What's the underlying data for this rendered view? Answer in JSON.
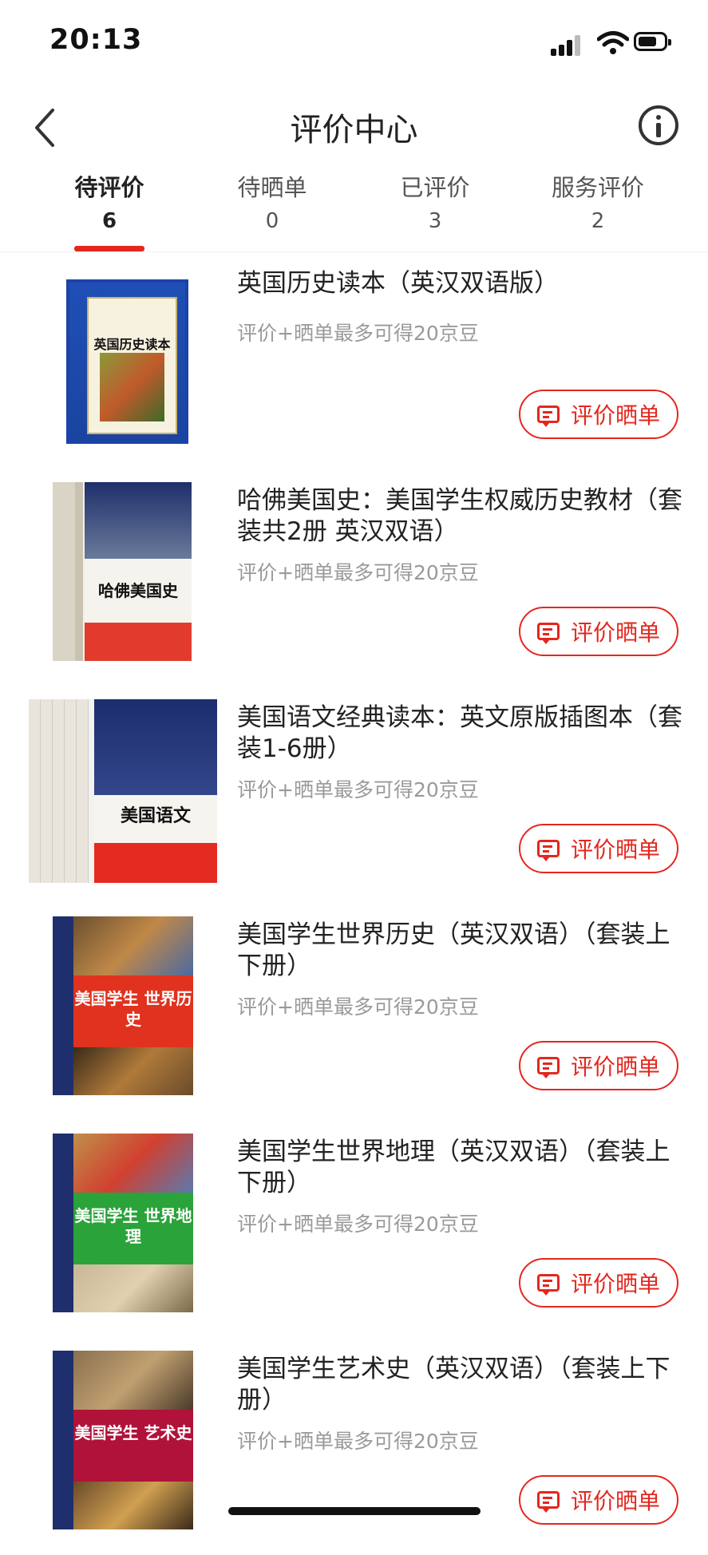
{
  "status": {
    "time": "20:13"
  },
  "nav": {
    "title": "评价中心"
  },
  "tabs": [
    {
      "label": "待评价",
      "count": "6",
      "active": true
    },
    {
      "label": "待晒单",
      "count": "0",
      "active": false
    },
    {
      "label": "已评价",
      "count": "3",
      "active": false
    },
    {
      "label": "服务评价",
      "count": "2",
      "active": false
    }
  ],
  "colors": {
    "accent": "#e4271e",
    "text": "#222222",
    "muted": "#9a9a9a"
  },
  "items": [
    {
      "title": "英国历史读本（英汉双语版）",
      "sub": "评价+晒单最多可得20京豆",
      "button": "评价晒单",
      "cover_text": "英国历史读本",
      "cover_colors": [
        "#1f4fb6",
        "#f6f2df"
      ]
    },
    {
      "title": "哈佛美国史：美国学生权威历史教材（套装共2册 英汉双语）",
      "sub": "评价+晒单最多可得20京豆",
      "button": "评价晒单",
      "cover_text": "哈佛美国史",
      "cover_colors": [
        "#1e2f6b",
        "#e23b2e"
      ]
    },
    {
      "title": "美国语文经典读本：英文原版插图本（套装1-6册）",
      "sub": "评价+晒单最多可得20京豆",
      "button": "评价晒单",
      "cover_text": "美国语文",
      "cover_colors": [
        "#1c2d6e",
        "#e52a22"
      ]
    },
    {
      "title": "美国学生世界历史（英汉双语）（套装上下册）",
      "sub": "评价+晒单最多可得20京豆",
      "button": "评价晒单",
      "cover_text": "美国学生 世界历史",
      "cover_colors": [
        "#2a3d8a",
        "#e0321f"
      ]
    },
    {
      "title": "美国学生世界地理（英汉双语）（套装上下册）",
      "sub": "评价+晒单最多可得20京豆",
      "button": "评价晒单",
      "cover_text": "美国学生 世界地理",
      "cover_colors": [
        "#2a3d8a",
        "#2aa33a"
      ]
    },
    {
      "title": "美国学生艺术史（英汉双语）（套装上下册）",
      "sub": "评价+晒单最多可得20京豆",
      "button": "评价晒单",
      "cover_text": "美国学生 艺术史",
      "cover_colors": [
        "#2a3d8a",
        "#b0123a"
      ]
    }
  ]
}
